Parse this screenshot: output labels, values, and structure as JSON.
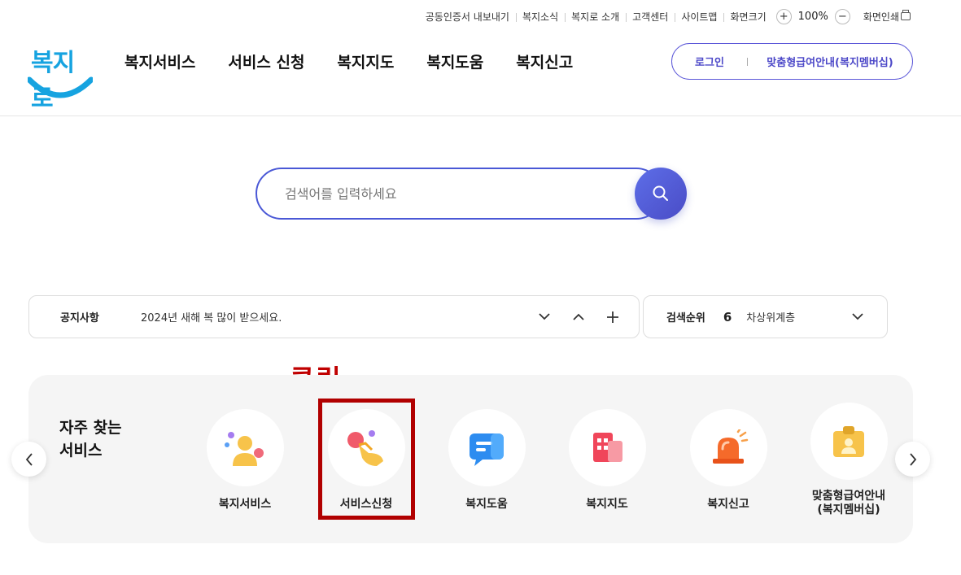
{
  "util": {
    "links": [
      "공동인증서 내보내기",
      "복지소식",
      "복지로 소개",
      "고객센터",
      "사이트맵",
      "화면크기"
    ],
    "zoom_in": "+",
    "zoom_value": "100%",
    "zoom_out": "−",
    "print": "화면인쇄"
  },
  "header": {
    "logo_text": "복지로",
    "nav": [
      "복지서비스",
      "서비스 신청",
      "복지지도",
      "복지도움",
      "복지신고"
    ],
    "login": "로그인",
    "membership": "맞춤형급여안내(복지멤버십)"
  },
  "search": {
    "placeholder": "검색어를 입력하세요"
  },
  "notice": {
    "title": "공지사항",
    "text": "2024년 새해 복 많이 받으세요."
  },
  "rank": {
    "title": "검색순위",
    "number": "6",
    "text": "차상위계층"
  },
  "annotation": {
    "label": "클릭"
  },
  "frequent": {
    "title": "자주 찾는 서비스",
    "items": [
      {
        "label": "복지서비스",
        "icon": "person-icon"
      },
      {
        "label": "서비스신청",
        "icon": "hand-click-icon"
      },
      {
        "label": "복지도움",
        "icon": "chat-icon"
      },
      {
        "label": "복지지도",
        "icon": "building-icon"
      },
      {
        "label": "복지신고",
        "icon": "siren-icon"
      },
      {
        "label": "맞춤형급여안내\n(복지멤버십)",
        "icon": "id-badge-icon"
      }
    ]
  },
  "colors": {
    "accent": "#4a58d6",
    "annotation": "#b10000",
    "logo": "#16a3e0"
  }
}
